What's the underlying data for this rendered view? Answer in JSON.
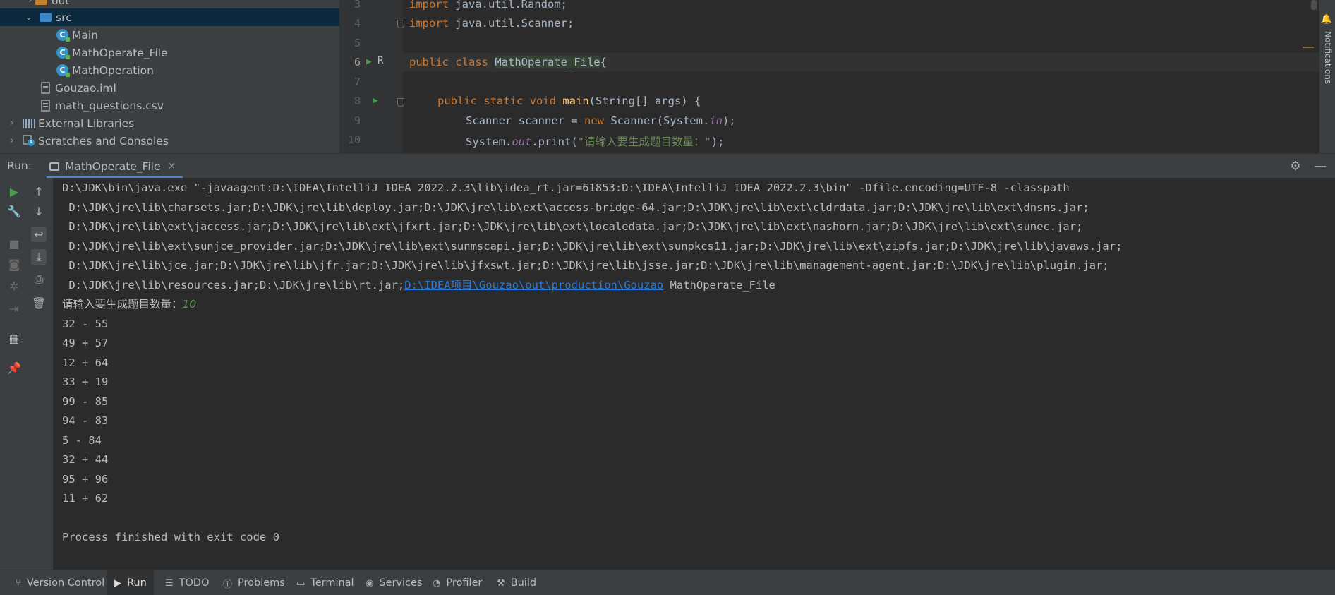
{
  "project_tree": {
    "items": [
      {
        "label": "out",
        "kind": "folder-orange",
        "expanded": false
      },
      {
        "label": "src",
        "kind": "folder-blue",
        "expanded": true
      },
      {
        "label": "Main",
        "kind": "class"
      },
      {
        "label": "MathOperate_File",
        "kind": "class"
      },
      {
        "label": "MathOperation",
        "kind": "class"
      },
      {
        "label": "Gouzao.iml",
        "kind": "file"
      },
      {
        "label": "math_questions.csv",
        "kind": "file"
      },
      {
        "label": "External Libraries",
        "kind": "libraries",
        "expanded": false
      },
      {
        "label": "Scratches and Consoles",
        "kind": "scratches",
        "expanded": false
      }
    ]
  },
  "editor": {
    "line_numbers": [
      "3",
      "4",
      "5",
      "6",
      "7",
      "8",
      "9",
      "10"
    ],
    "current_line": "6",
    "code": {
      "l3_kw": "import",
      "l3_rest": " java.util.Random;",
      "l4_kw": "import",
      "l4_rest": " java.util.Scanner;",
      "l6_kw": "public class",
      "l6_cls": "MathOperate_File",
      "l6_rest": "{",
      "l8_kw": "public static void",
      "l8_fn": "main",
      "l8_rest": "(String[] args) {",
      "l9_a": "Scanner scanner = ",
      "l9_kw": "new",
      "l9_b": " Scanner(System.",
      "l9_stat": "in",
      "l9_c": ");",
      "l10_a": "System.",
      "l10_stat": "out",
      "l10_b": ".print(",
      "l10_str": "\"请输入要生成题目数量：\"",
      "l10_c": ");"
    },
    "notifications_label": "Notifications"
  },
  "run_panel": {
    "label": "Run:",
    "tab_title": "MathOperate_File",
    "console": {
      "cmd_lines": [
        "D:\\JDK\\bin\\java.exe \"-javaagent:D:\\IDEA\\IntelliJ IDEA 2022.2.3\\lib\\idea_rt.jar=61853:D:\\IDEA\\IntelliJ IDEA 2022.2.3\\bin\" -Dfile.encoding=UTF-8 -classpath",
        " D:\\JDK\\jre\\lib\\charsets.jar;D:\\JDK\\jre\\lib\\deploy.jar;D:\\JDK\\jre\\lib\\ext\\access-bridge-64.jar;D:\\JDK\\jre\\lib\\ext\\cldrdata.jar;D:\\JDK\\jre\\lib\\ext\\dnsns.jar;",
        " D:\\JDK\\jre\\lib\\ext\\jaccess.jar;D:\\JDK\\jre\\lib\\ext\\jfxrt.jar;D:\\JDK\\jre\\lib\\ext\\localedata.jar;D:\\JDK\\jre\\lib\\ext\\nashorn.jar;D:\\JDK\\jre\\lib\\ext\\sunec.jar;",
        " D:\\JDK\\jre\\lib\\ext\\sunjce_provider.jar;D:\\JDK\\jre\\lib\\ext\\sunmscapi.jar;D:\\JDK\\jre\\lib\\ext\\sunpkcs11.jar;D:\\JDK\\jre\\lib\\ext\\zipfs.jar;D:\\JDK\\jre\\lib\\javaws.jar;",
        " D:\\JDK\\jre\\lib\\jce.jar;D:\\JDK\\jre\\lib\\jfr.jar;D:\\JDK\\jre\\lib\\jfxswt.jar;D:\\JDK\\jre\\lib\\jsse.jar;D:\\JDK\\jre\\lib\\management-agent.jar;D:\\JDK\\jre\\lib\\plugin.jar;"
      ],
      "last_cmd_prefix": " D:\\JDK\\jre\\lib\\resources.jar;D:\\JDK\\jre\\lib\\rt.jar;",
      "last_cmd_link": "D:\\IDEA项目\\Gouzao\\out\\production\\Gouzao",
      "last_cmd_suffix": " MathOperate_File",
      "prompt": "请输入要生成题目数量：",
      "user_input": "10",
      "questions": [
        "32 - 55",
        "49 + 57",
        "12 + 64",
        "33 + 19",
        "99 - 85",
        "94 - 83",
        "5 - 84",
        "32 + 44",
        "95 + 96",
        "11 + 62"
      ],
      "exit_message": "Process finished with exit code 0"
    }
  },
  "bottom_bar": {
    "items": [
      {
        "label": "Version Control",
        "icon": "branch-icon"
      },
      {
        "label": "Run",
        "icon": "play-icon",
        "active": true
      },
      {
        "label": "TODO",
        "icon": "list-icon"
      },
      {
        "label": "Problems",
        "icon": "warning-icon"
      },
      {
        "label": "Terminal",
        "icon": "terminal-icon"
      },
      {
        "label": "Services",
        "icon": "services-icon"
      },
      {
        "label": "Profiler",
        "icon": "profiler-icon"
      },
      {
        "label": "Build",
        "icon": "hammer-icon"
      }
    ]
  },
  "colors": {
    "panel_bg": "#3c3f41",
    "editor_bg": "#2b2b2b",
    "keyword": "#cc7832",
    "string": "#6a8759",
    "link": "#287bde",
    "accent": "#4a88c7"
  }
}
